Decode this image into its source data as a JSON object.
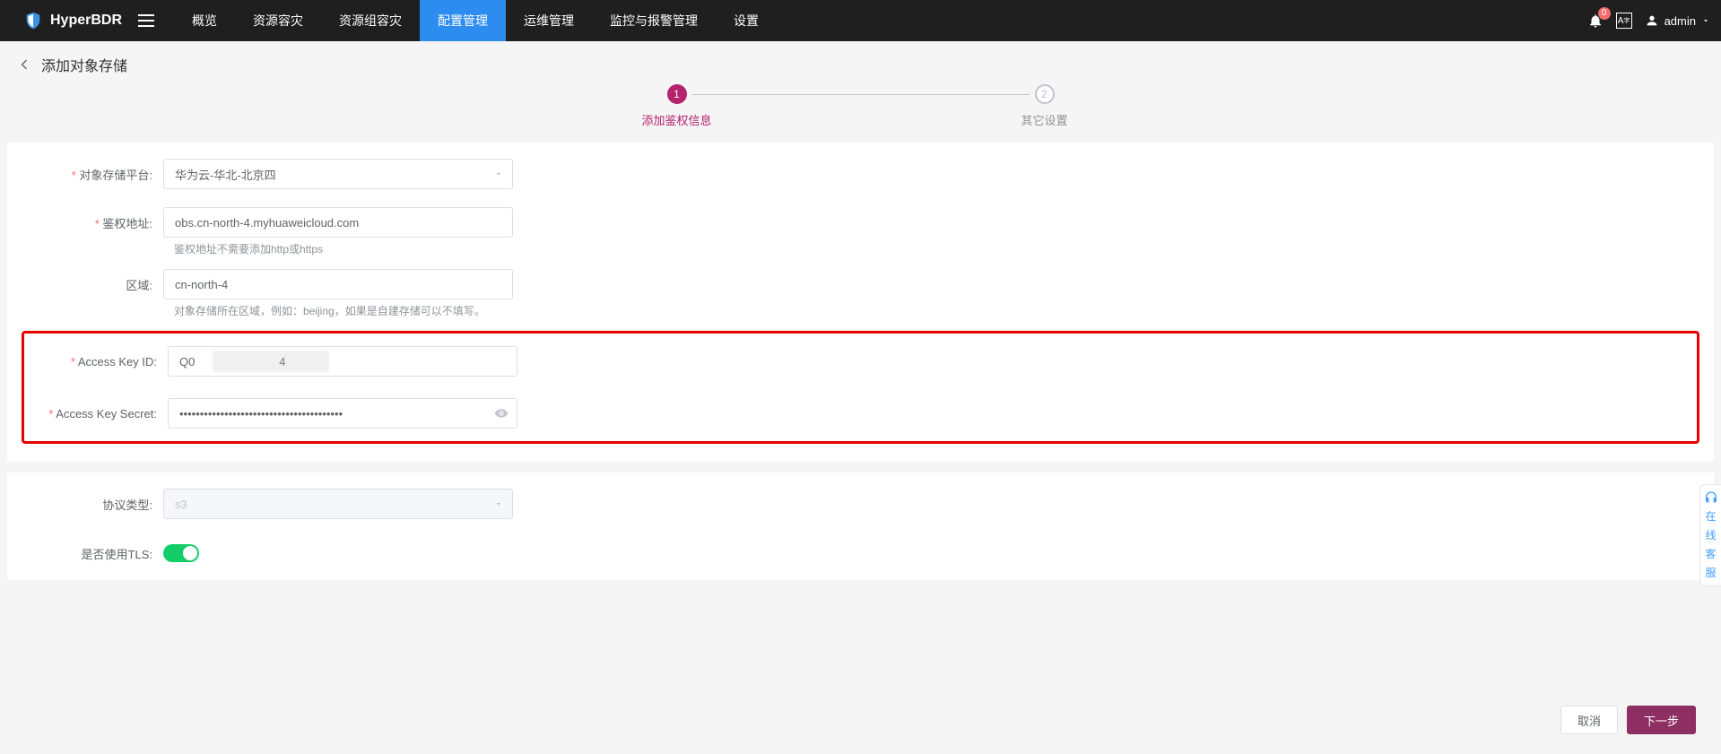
{
  "brand": "HyperBDR",
  "nav": {
    "items": [
      {
        "label": "概览"
      },
      {
        "label": "资源容灾"
      },
      {
        "label": "资源组容灾"
      },
      {
        "label": "配置管理",
        "active": true
      },
      {
        "label": "运维管理"
      },
      {
        "label": "监控与报警管理"
      },
      {
        "label": "设置"
      }
    ]
  },
  "notifications": {
    "count": "0"
  },
  "lang_label": "A",
  "user": {
    "name": "admin"
  },
  "page": {
    "title": "添加对象存储"
  },
  "steps": [
    {
      "num": "1",
      "label": "添加鉴权信息",
      "state": "active"
    },
    {
      "num": "2",
      "label": "其它设置",
      "state": "inactive"
    }
  ],
  "form": {
    "platform": {
      "label": "对象存储平台:",
      "value": "华为云-华北-北京四"
    },
    "auth_addr": {
      "label": "鉴权地址:",
      "value": "obs.cn-north-4.myhuaweicloud.com",
      "hint": "鉴权地址不需要添加http或https"
    },
    "region": {
      "label": "区域:",
      "value": "cn-north-4",
      "hint": "对象存储所在区域，例如：beijing，如果是自建存储可以不填写。"
    },
    "ak": {
      "label": "Access Key ID:",
      "value_prefix": "Q0",
      "value_suffix": "4"
    },
    "sk": {
      "label": "Access Key Secret:",
      "value": "••••••••••••••••••••••••••••••••••••••••"
    },
    "protocol": {
      "label": "协议类型:",
      "value": "s3"
    },
    "tls": {
      "label": "是否使用TLS:",
      "on": true
    }
  },
  "buttons": {
    "cancel": "取消",
    "next": "下一步"
  },
  "help": {
    "label_chars": [
      "在",
      "线",
      "客",
      "服"
    ]
  }
}
